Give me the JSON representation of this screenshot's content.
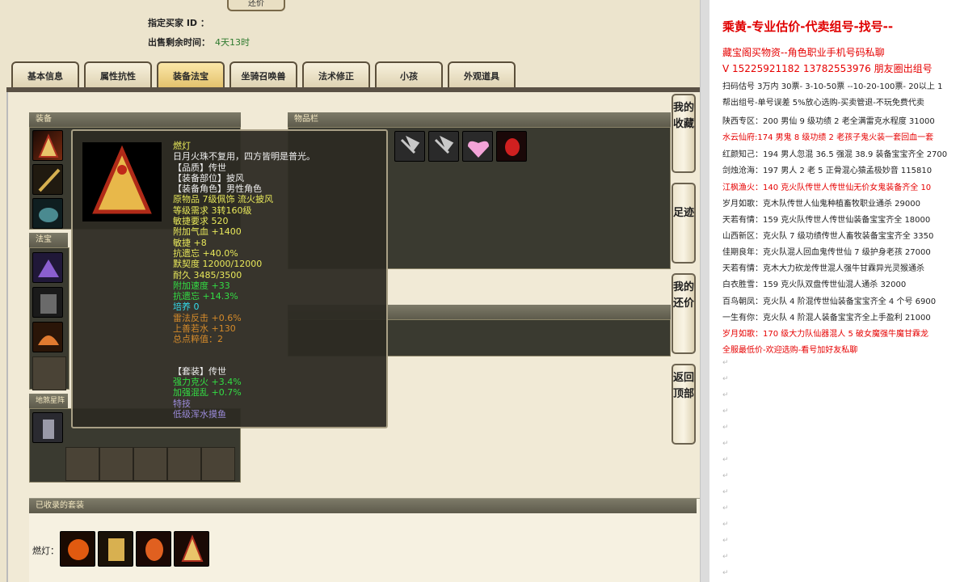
{
  "header": {
    "bid_button": "还价",
    "buyer_label": "指定买家 ID ：",
    "time_label": "出售剩余时间：",
    "time_value": "4天13时"
  },
  "tabs": [
    "基本信息",
    "属性抗性",
    "装备法宝",
    "坐骑召唤兽",
    "法术修正",
    "小孩",
    "外观道具"
  ],
  "active_tab": 2,
  "panels": {
    "equip": "装备",
    "inventory": "物品栏",
    "fabao": "法宝",
    "dishabao": "地煞星阵"
  },
  "tooltip": {
    "lines": [
      {
        "text": "燃灯",
        "color": "#e8e85a"
      },
      {
        "text": "日月火珠不复用，四方皆明是普光。",
        "color": "#f0f0f0"
      },
      {
        "text": "【品质】传世",
        "color": "#f0f0f0"
      },
      {
        "text": "【装备部位】披风",
        "color": "#f0f0f0"
      },
      {
        "text": "【装备角色】男性角色",
        "color": "#f0f0f0"
      },
      {
        "text": "原物品 7级佩饰 流火披风",
        "color": "#e8e85a"
      },
      {
        "text": "等级需求 3转160级",
        "color": "#e8e85a"
      },
      {
        "text": "敏捷要求 520",
        "color": "#e8e85a"
      },
      {
        "text": "附加气血 +1400",
        "color": "#e8e85a"
      },
      {
        "text": "敏捷 +8",
        "color": "#e8e85a"
      },
      {
        "text": "抗遗忘 +40.0%",
        "color": "#e8e85a"
      },
      {
        "text": "默契度 12000/12000",
        "color": "#e8e85a"
      },
      {
        "text": "耐久 3485/3500",
        "color": "#e8e85a"
      },
      {
        "text": "附加速度 +33",
        "color": "#33dd44"
      },
      {
        "text": "抗遗忘 +14.3%",
        "color": "#33dd44"
      },
      {
        "text": "培养 0",
        "color": "#33ddee"
      },
      {
        "text": "雷法反击 +0.6%",
        "color": "#d48a2a"
      },
      {
        "text": "上善若水 +130",
        "color": "#d48a2a"
      },
      {
        "text": "总点粹值：2",
        "color": "#d48a2a"
      },
      {
        "text": "",
        "color": "#f0f0f0"
      },
      {
        "text": "",
        "color": "#f0f0f0"
      },
      {
        "text": "【套装】传世",
        "color": "#f0f0f0"
      },
      {
        "text": "强力克火 +3.4%",
        "color": "#33dd44"
      },
      {
        "text": "加强混乱 +0.7%",
        "color": "#33dd44"
      },
      {
        "text": "特技",
        "color": "#9a8ad8"
      },
      {
        "text": "低级浑水摸鱼",
        "color": "#9a8ad8"
      }
    ]
  },
  "side_buttons": [
    "我的收藏",
    "足迹",
    "我的还价",
    "返回顶部"
  ],
  "sets": {
    "title": "已收录的套装",
    "label": "燃灯："
  },
  "right_panel": {
    "title": "乘黄-专业估价-代卖组号-找号--",
    "lines": [
      {
        "text": "藏宝阁买物资--角色职业手机号码私聊",
        "red": true
      },
      {
        "text": "V 15225921182   13782553976 朋友圈出组号",
        "red": true
      },
      {
        "text": "扫码估号 3万内 30票- 3-10-50票  --10-20-100票- 20以上 1",
        "red": false
      },
      {
        "text": "帮出组号-单号误差 5%放心选购-买卖管退-不玩免费代卖",
        "red": false
      },
      {
        "text": "陕西专区：200 男仙 9 级功绩 2 老全满雷克水程度 31000",
        "red": false
      },
      {
        "text": "水云仙府:174 男鬼 8 级功绩 2 老孩子鬼火装一套回血一套",
        "red": true
      },
      {
        "text": "红颜知己：194 男人忽混 36.5 强混 38.9 装备宝宝齐全 2700",
        "red": false
      },
      {
        "text": "剑烛沧海：197 男人 2 老 5 正骨混心猿孟极妙音 115810",
        "red": false
      },
      {
        "text": "江枫渔火：140 克火队传世人传世仙无价女鬼装备齐全 10",
        "red": true
      },
      {
        "text": "岁月如歌：克木队传世人仙鬼种植畜牧职业通杀 29000",
        "red": false
      },
      {
        "text": "天若有情：159 克火队传世人传世仙装备宝宝齐全 18000",
        "red": false
      },
      {
        "text": "山西新区：克火队 7 级功绩传世人畜牧装备宝宝齐全 3350",
        "red": false
      },
      {
        "text": "佳期良年：克火队混人回血鬼传世仙 7 级护身老孩 27000",
        "red": false
      },
      {
        "text": "天若有情：克木大力砍龙传世混人强牛甘霖异光灵猴通杀",
        "red": false
      },
      {
        "text": "白衣胜雪：159 克火队双盘传世仙混人通杀 32000",
        "red": false
      },
      {
        "text": "百鸟朝凤：克火队 4 阶混传世仙装备宝宝齐全 4 个号 6900",
        "red": false
      },
      {
        "text": "一生有你：克火队 4 阶混人装备宝宝齐全上手盈利 21000",
        "red": false
      },
      {
        "text": "岁月如歌：170 级大力队仙器混人 5 破女魔强牛魔甘霖龙",
        "red": true
      },
      {
        "text": "全服最低价-欢迎选购-看号加好友私聊",
        "red": true
      }
    ]
  },
  "colors": {
    "accent_red": "#e60000",
    "panel_bg": "#3a3a30"
  },
  "icons": [
    "lantern-cloak-icon",
    "sword-icon",
    "armor-icon",
    "dagger-icon",
    "wing-icon",
    "gem-icon",
    "fan-icon",
    "tablet-icon",
    "dumpling-icon",
    "chess-piece-icon",
    "axe-icon",
    "heart-gem-icon",
    "red-orb-icon",
    "flame-icon"
  ]
}
